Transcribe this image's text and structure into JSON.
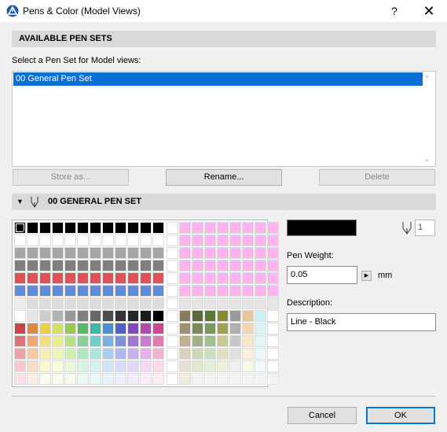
{
  "window": {
    "title": "Pens & Color (Model Views)",
    "help_label": "?",
    "close_label": "✕"
  },
  "available_pen_sets": {
    "header": "AVAILABLE PEN SETS",
    "select_label": "Select a Pen Set for Model views:",
    "items": [
      "00 General Pen Set"
    ],
    "selected_index": 0,
    "buttons": {
      "store_as": "Store as...",
      "rename": "Rename...",
      "delete": "Delete"
    }
  },
  "pen_set": {
    "header": "00 GENERAL PEN SET",
    "selected_pen_number": "1",
    "selected_pen_color": "#000000",
    "pen_weight_label": "Pen Weight:",
    "pen_weight_value": "0.05",
    "pen_weight_unit": "mm",
    "description_label": "Description:",
    "description_value": "Line - Black"
  },
  "palette": {
    "rows": [
      [
        "#000000",
        "#000000",
        "#000000",
        "#000000",
        "#000000",
        "#000000",
        "#000000",
        "#000000",
        "#000000",
        "#000000",
        "#000000",
        "#000000",
        "#ffffff",
        "#ffb3f0",
        "#ffb3f0",
        "#ffb3f0",
        "#ffb3f0",
        "#ffb3f0",
        "#ffb3f0",
        "#ffb3f0",
        "#ffb3f0"
      ],
      [
        "#ffffff",
        "#ffffff",
        "#ffffff",
        "#ffffff",
        "#ffffff",
        "#ffffff",
        "#ffffff",
        "#ffffff",
        "#ffffff",
        "#ffffff",
        "#ffffff",
        "#ffffff",
        "#ffffff",
        "#ffb3f0",
        "#ffb3f0",
        "#ffb3f0",
        "#ffb3f0",
        "#ffb3f0",
        "#ffb3f0",
        "#ffb3f0",
        "#ffb3f0"
      ],
      [
        "#a6a6a6",
        "#a6a6a6",
        "#a6a6a6",
        "#a6a6a6",
        "#a6a6a6",
        "#a6a6a6",
        "#a6a6a6",
        "#a6a6a6",
        "#a6a6a6",
        "#a6a6a6",
        "#a6a6a6",
        "#a6a6a6",
        "#ffffff",
        "#ffb3f0",
        "#ffb3f0",
        "#ffb3f0",
        "#ffb3f0",
        "#ffb3f0",
        "#ffb3f0",
        "#ffb3f0",
        "#ffb3f0"
      ],
      [
        "#808080",
        "#808080",
        "#808080",
        "#808080",
        "#808080",
        "#808080",
        "#808080",
        "#808080",
        "#808080",
        "#808080",
        "#808080",
        "#808080",
        "#ffffff",
        "#ffb3f0",
        "#ffb3f0",
        "#ffb3f0",
        "#ffb3f0",
        "#ffb3f0",
        "#ffb3f0",
        "#ffb3f0",
        "#ffb3f0"
      ],
      [
        "#e0525a",
        "#e0525a",
        "#e0525a",
        "#e0525a",
        "#e0525a",
        "#e0525a",
        "#e0525a",
        "#e0525a",
        "#e0525a",
        "#e0525a",
        "#e0525a",
        "#e0525a",
        "#ffffff",
        "#ffb3f0",
        "#ffb3f0",
        "#ffb3f0",
        "#ffb3f0",
        "#ffb3f0",
        "#ffb3f0",
        "#ffb3f0",
        "#ffb3f0"
      ],
      [
        "#5b8fd9",
        "#5b8fd9",
        "#5b8fd9",
        "#5b8fd9",
        "#5b8fd9",
        "#5b8fd9",
        "#5b8fd9",
        "#5b8fd9",
        "#5b8fd9",
        "#5b8fd9",
        "#5b8fd9",
        "#5b8fd9",
        "#ffffff",
        "#ffb3f0",
        "#ffb3f0",
        "#ffb3f0",
        "#ffb3f0",
        "#ffb3f0",
        "#ffb3f0",
        "#ffb3f0",
        "#ffb3f0"
      ],
      [
        "#eeeeee",
        "#dcdcdc",
        "#dcdcdc",
        "#dcdcdc",
        "#dcdcdc",
        "#dcdcdc",
        "#dcdcdc",
        "#dcdcdc",
        "#dcdcdc",
        "#dcdcdc",
        "#dcdcdc",
        "#dcdcdc",
        "#ffffff",
        "#e6e6e6",
        "#e6e6e6",
        "#e6e6e6",
        "#e6e6e6",
        "#e6e6e6",
        "#e6e6e6",
        "#e6e6e6",
        "#e6e6e6"
      ],
      [
        "#ffffff",
        "#e6e6e6",
        "#cccccc",
        "#b3b3b3",
        "#999999",
        "#808080",
        "#666666",
        "#4d4d4d",
        "#333333",
        "#262626",
        "#1a1a1a",
        "#000000",
        "#ffffff",
        "#8a7a5a",
        "#5a6a3a",
        "#5a7a3a",
        "#8a8a30",
        "#9a9a9a",
        "#e8c896",
        "#c8f0f8",
        "#ffffff"
      ],
      [
        "#c8464b",
        "#e08840",
        "#e8d048",
        "#d8e060",
        "#98c850",
        "#58b868",
        "#40b8a8",
        "#4890d0",
        "#5060c8",
        "#8048c0",
        "#b048b0",
        "#d04890",
        "#ffffff",
        "#a09070",
        "#7a8a5a",
        "#7a9a5a",
        "#a0a050",
        "#b0b0b0",
        "#f0d8b0",
        "#d8f4fa",
        "#ffffff"
      ],
      [
        "#e07078",
        "#f0a870",
        "#f0e078",
        "#e8f088",
        "#b8e080",
        "#88d098",
        "#70d0c8",
        "#78b0e8",
        "#8090e0",
        "#a078d8",
        "#d078d0",
        "#e878b0",
        "#ffffff",
        "#c0b090",
        "#a0b080",
        "#a0c090",
        "#c8c890",
        "#c8c8c8",
        "#f8e8c8",
        "#e0f6fa",
        "#ffffff"
      ],
      [
        "#f0a0a8",
        "#f8c8a0",
        "#f8f0a8",
        "#f0f8b0",
        "#d0f0b0",
        "#b0e8c0",
        "#a8e8e0",
        "#a8d0f0",
        "#b0b8f0",
        "#c8b0f0",
        "#e8b0e8",
        "#f8b0d0",
        "#ffffff",
        "#d8d0b8",
        "#c8d8b8",
        "#c8e0c0",
        "#e0e0c0",
        "#e0e0e0",
        "#fcf0d8",
        "#e8f8fc",
        "#ffffff"
      ],
      [
        "#f8c8d0",
        "#fcdcc8",
        "#fcf8d0",
        "#f8fcd8",
        "#e8f8d8",
        "#d8f4e0",
        "#d0f4f0",
        "#d0e4f8",
        "#d8dcf8",
        "#e4d8f8",
        "#f4d8f4",
        "#fcd8e8",
        "#ffffff",
        "#e8e0d0",
        "#e0e8d0",
        "#e0f0d8",
        "#f0f0d8",
        "#f0f0f0",
        "#fcf8e8",
        "#f0fafc",
        "#ffffff"
      ],
      [
        "#fce0e4",
        "#fcece0",
        "#fcfce8",
        "#fcfcec",
        "#f4fcec",
        "#ecfaf0",
        "#e8faf8",
        "#e8f2fc",
        "#eceefc",
        "#f2ecfc",
        "#faecfa",
        "#fcecf4",
        "#ffffff",
        "#f0ecdc",
        "",
        "",
        "",
        "",
        "",
        "",
        ""
      ]
    ]
  }
}
